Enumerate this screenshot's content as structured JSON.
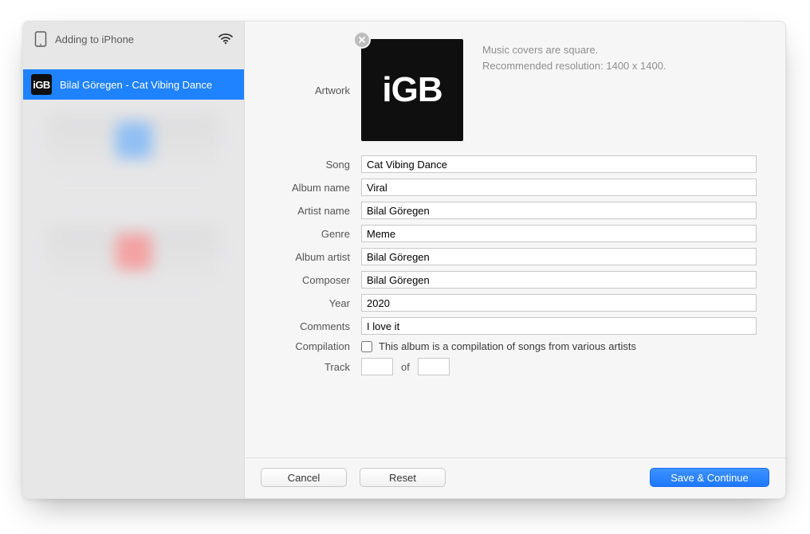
{
  "sidebar": {
    "status": "Adding to iPhone",
    "tracks": [
      {
        "name": "Bilal Göregen - Cat Vibing Dance"
      }
    ]
  },
  "artwork": {
    "label": "Artwork",
    "logo_text": "iGB",
    "hint_line1": "Music covers are square.",
    "hint_line2": "Recommended resolution: 1400 x 1400."
  },
  "fields": {
    "song": {
      "label": "Song",
      "value": "Cat Vibing Dance"
    },
    "album_name": {
      "label": "Album name",
      "value": "Viral"
    },
    "artist_name": {
      "label": "Artist name",
      "value": "Bilal Göregen"
    },
    "genre": {
      "label": "Genre",
      "value": "Meme"
    },
    "album_artist": {
      "label": "Album artist",
      "value": "Bilal Göregen"
    },
    "composer": {
      "label": "Composer",
      "value": "Bilal Göregen"
    },
    "year": {
      "label": "Year",
      "value": "2020"
    },
    "comments": {
      "label": "Comments",
      "value": "I love it"
    },
    "compilation": {
      "label": "Compilation",
      "checkbox_label": "This album is a compilation of songs from various artists",
      "checked": false
    },
    "track": {
      "label": "Track",
      "num": "",
      "of_label": "of",
      "total": ""
    }
  },
  "buttons": {
    "cancel": "Cancel",
    "reset": "Reset",
    "save": "Save & Continue"
  },
  "icons": {
    "device": "ipad-icon",
    "wifi": "wifi-icon",
    "close": "close-icon"
  }
}
